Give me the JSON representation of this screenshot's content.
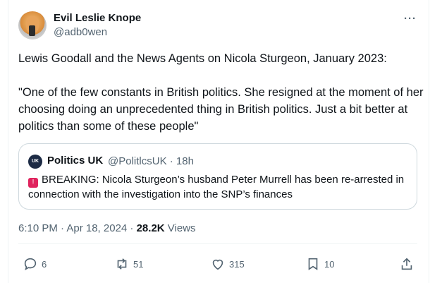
{
  "author": {
    "name": "Evil Leslie Knope",
    "handle": "@adb0wen"
  },
  "tweet": {
    "line1": "Lewis Goodall and the News Agents on Nicola Sturgeon, January 2023:",
    "line2": "\"One of the few constants in British politics. She resigned at the moment of her choosing doing an unprecedented thing in British politics. Just a bit better at politics than some of these people\""
  },
  "quote": {
    "avatar_text": "UK",
    "name": "Politics UK",
    "handle_time": "@PolitlcsUK · 18h",
    "body": "BREAKING: Nicola Sturgeon’s husband Peter Murrell has been re-arrested in connection with the investigation into the SNP’s finances"
  },
  "meta": {
    "time": "6:10 PM · Apr 18, 2024 · ",
    "views_count": "28.2K",
    "views_label": " Views"
  },
  "actions": {
    "replies": "6",
    "retweets": "51",
    "likes": "315",
    "bookmarks": "10"
  },
  "more_label": "···",
  "colors": {
    "text": "#0f1419",
    "muted": "#536471",
    "border": "#cfd9de"
  }
}
